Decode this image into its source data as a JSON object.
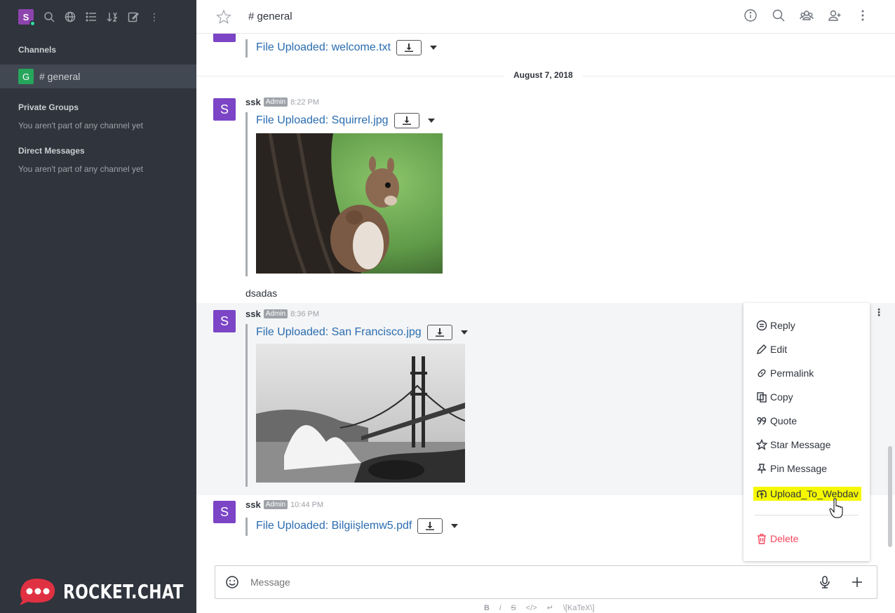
{
  "sidebar": {
    "avatar_letter": "S",
    "channels_title": "Channels",
    "channel": {
      "avatar_letter": "G",
      "name": "# general"
    },
    "private_groups_title": "Private Groups",
    "private_groups_empty": "You aren't part of any channel yet",
    "direct_messages_title": "Direct Messages",
    "direct_messages_empty": "You aren't part of any channel yet",
    "logo_text": "ROCKET.CHAT"
  },
  "header": {
    "room_title": "# general"
  },
  "messages": {
    "partial": {
      "file_label": "File Uploaded: welcome.txt"
    },
    "date_separator": "August 7, 2018",
    "m1": {
      "avatar_letter": "S",
      "user": "ssk",
      "role": "Admin",
      "time": "8:22 PM",
      "file_label": "File Uploaded: Squirrel.jpg",
      "text": "dsadas"
    },
    "m2": {
      "avatar_letter": "S",
      "user": "ssk",
      "role": "Admin",
      "time": "8:36 PM",
      "file_label": "File Uploaded: San Francisco.jpg"
    },
    "m3": {
      "avatar_letter": "S",
      "user": "ssk",
      "role": "Admin",
      "time": "10:44 PM",
      "file_label": "File Uploaded: Bilgiişlemw5.pdf"
    }
  },
  "context_menu": {
    "reply": "Reply",
    "edit": "Edit",
    "permalink": "Permalink",
    "copy": "Copy",
    "quote": "Quote",
    "star": "Star Message",
    "pin": "Pin Message",
    "upload": "Upload_To_Webdav",
    "delete": "Delete",
    "highlight_color": "#f5f800",
    "delete_color": "#f5455c"
  },
  "composer": {
    "placeholder": "Message",
    "format_bold": "B",
    "format_italic": "i",
    "format_strike": "S",
    "format_code": "</>",
    "format_katex": "\\[KaTeX\\]"
  },
  "colors": {
    "sidebar_bg": "#2f343d",
    "link": "#2a6cb0",
    "avatar": "#7b45c6"
  }
}
